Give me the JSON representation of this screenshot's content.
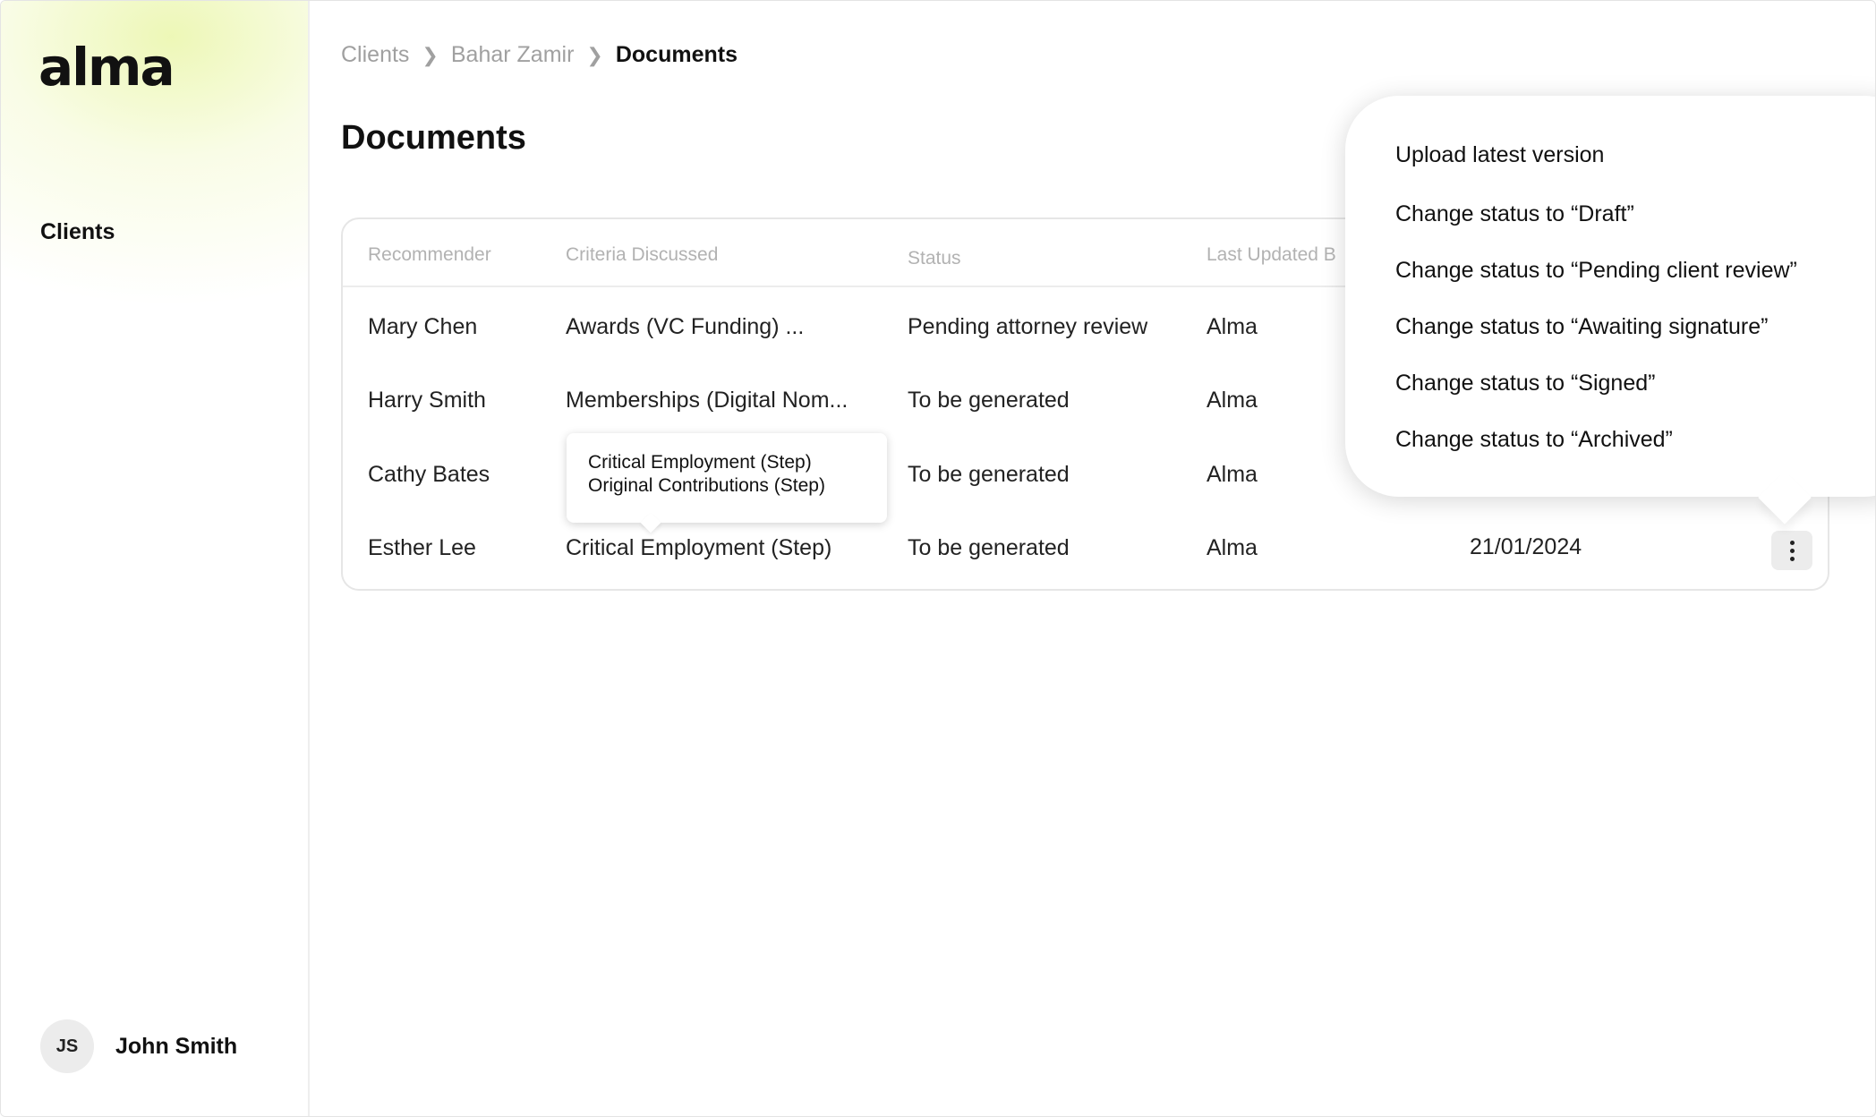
{
  "app": {
    "logo": "alma"
  },
  "sidebar": {
    "nav": [
      "Clients"
    ]
  },
  "user": {
    "initials": "JS",
    "name": "John Smith"
  },
  "breadcrumb": [
    "Clients",
    "Bahar Zamir",
    "Documents"
  ],
  "page": {
    "title": "Documents"
  },
  "table": {
    "headers": [
      "Recommender",
      "Criteria Discussed",
      "Status",
      "Last Updated B"
    ],
    "rows": [
      {
        "recommender": "Mary Chen",
        "criteria": "Awards (VC Funding) ...",
        "status": "Pending attorney review",
        "updated_by": "Alma",
        "date": ""
      },
      {
        "recommender": "Harry Smith",
        "criteria": "Memberships (Digital Nom...",
        "status": "To be generated",
        "updated_by": "Alma",
        "date": ""
      },
      {
        "recommender": "Cathy Bates",
        "criteria": "",
        "status": "To be generated",
        "updated_by": "Alma",
        "date": ""
      },
      {
        "recommender": "Esther Lee",
        "criteria": "Critical Employment (Step)",
        "status": "To be generated",
        "updated_by": "Alma",
        "date": "21/01/2024"
      }
    ]
  },
  "tooltip": {
    "lines": [
      "Critical Employment (Step)",
      "Original Contributions (Step)"
    ]
  },
  "menu": {
    "items": [
      "Upload latest version",
      "Change status to “Draft”",
      "Change status to “Pending client review”",
      "Change status to “Awaiting signature”",
      "Change status to “Signed”",
      "Change status to “Archived”"
    ]
  }
}
